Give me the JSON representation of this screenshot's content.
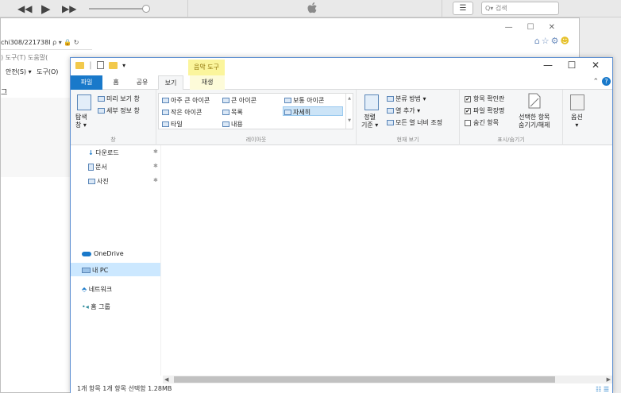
{
  "itunes": {
    "prev": "◀◀",
    "play": "▶",
    "next": "▶▶",
    "list_icon": "☰",
    "search_placeholder": "Q▾ 검색"
  },
  "ie": {
    "window_controls": [
      "—",
      "☐",
      "✕"
    ],
    "address_text": "chi308/221738I",
    "address_icons": "ρ ▾ 🔒 ↻",
    "favorites_icons": "⌂☆⚙",
    "smiley": "☻",
    "menu_text": ") 도구(T) 도움말(",
    "commands": [
      "안전(S) ▾",
      "도구(O)"
    ],
    "page_title": "그"
  },
  "explorer": {
    "qat_separator": "|",
    "qat_dropdown": "▾",
    "context_tool_title": "음악 도구",
    "window_controls": [
      "—",
      "☐",
      "✕"
    ],
    "tabs": {
      "file": "파일",
      "home": "홈",
      "share": "공유",
      "view": "보기",
      "play": "재생"
    },
    "ribbon_right": "⌃",
    "help": "?",
    "pane_group": {
      "nav_pane": "탐색\n창 ▾",
      "preview_pane": "미리 보기 창",
      "details_pane": "세부 정보 창",
      "label": "창"
    },
    "layout_group": {
      "items": [
        "아주 큰 아이콘",
        "큰 아이콘",
        "보통 아이콘",
        "작은 아이콘",
        "목록",
        "자세히",
        "타일",
        "내용"
      ],
      "scroll_up": "▲",
      "scroll_down": "▼",
      "label": "레이아웃"
    },
    "current_view_group": {
      "sort": "정렬\n기준 ▾",
      "group_by": "분류 방법 ▾",
      "add_column": "열 추가 ▾",
      "fit_columns": "모든 열 너비 조정",
      "label": "현재 보기"
    },
    "showhide_group": {
      "item_checkboxes": "항목 확인란",
      "file_extensions": "파일 확장명",
      "hidden_items": "숨긴 항목",
      "item_checkboxes_checked": "✔",
      "file_extensions_checked": "✔",
      "hide_selected": "선택한 항목\n숨기기/해제",
      "label": "표시/숨기기"
    },
    "options": "옵션\n▾",
    "nav": {
      "downloads": "다운로드",
      "documents": "문서",
      "pictures": "사진",
      "onedrive": "OneDrive",
      "this_pc": "내 PC",
      "network": "네트워크",
      "homegroup": "홈 그룹",
      "pin": "✱"
    },
    "scroll": {
      "left": "◀",
      "right": "▶"
    },
    "status": "1개 항목     1개 항목 선택함 1.28MB",
    "view_icons": "☷ ☰"
  }
}
